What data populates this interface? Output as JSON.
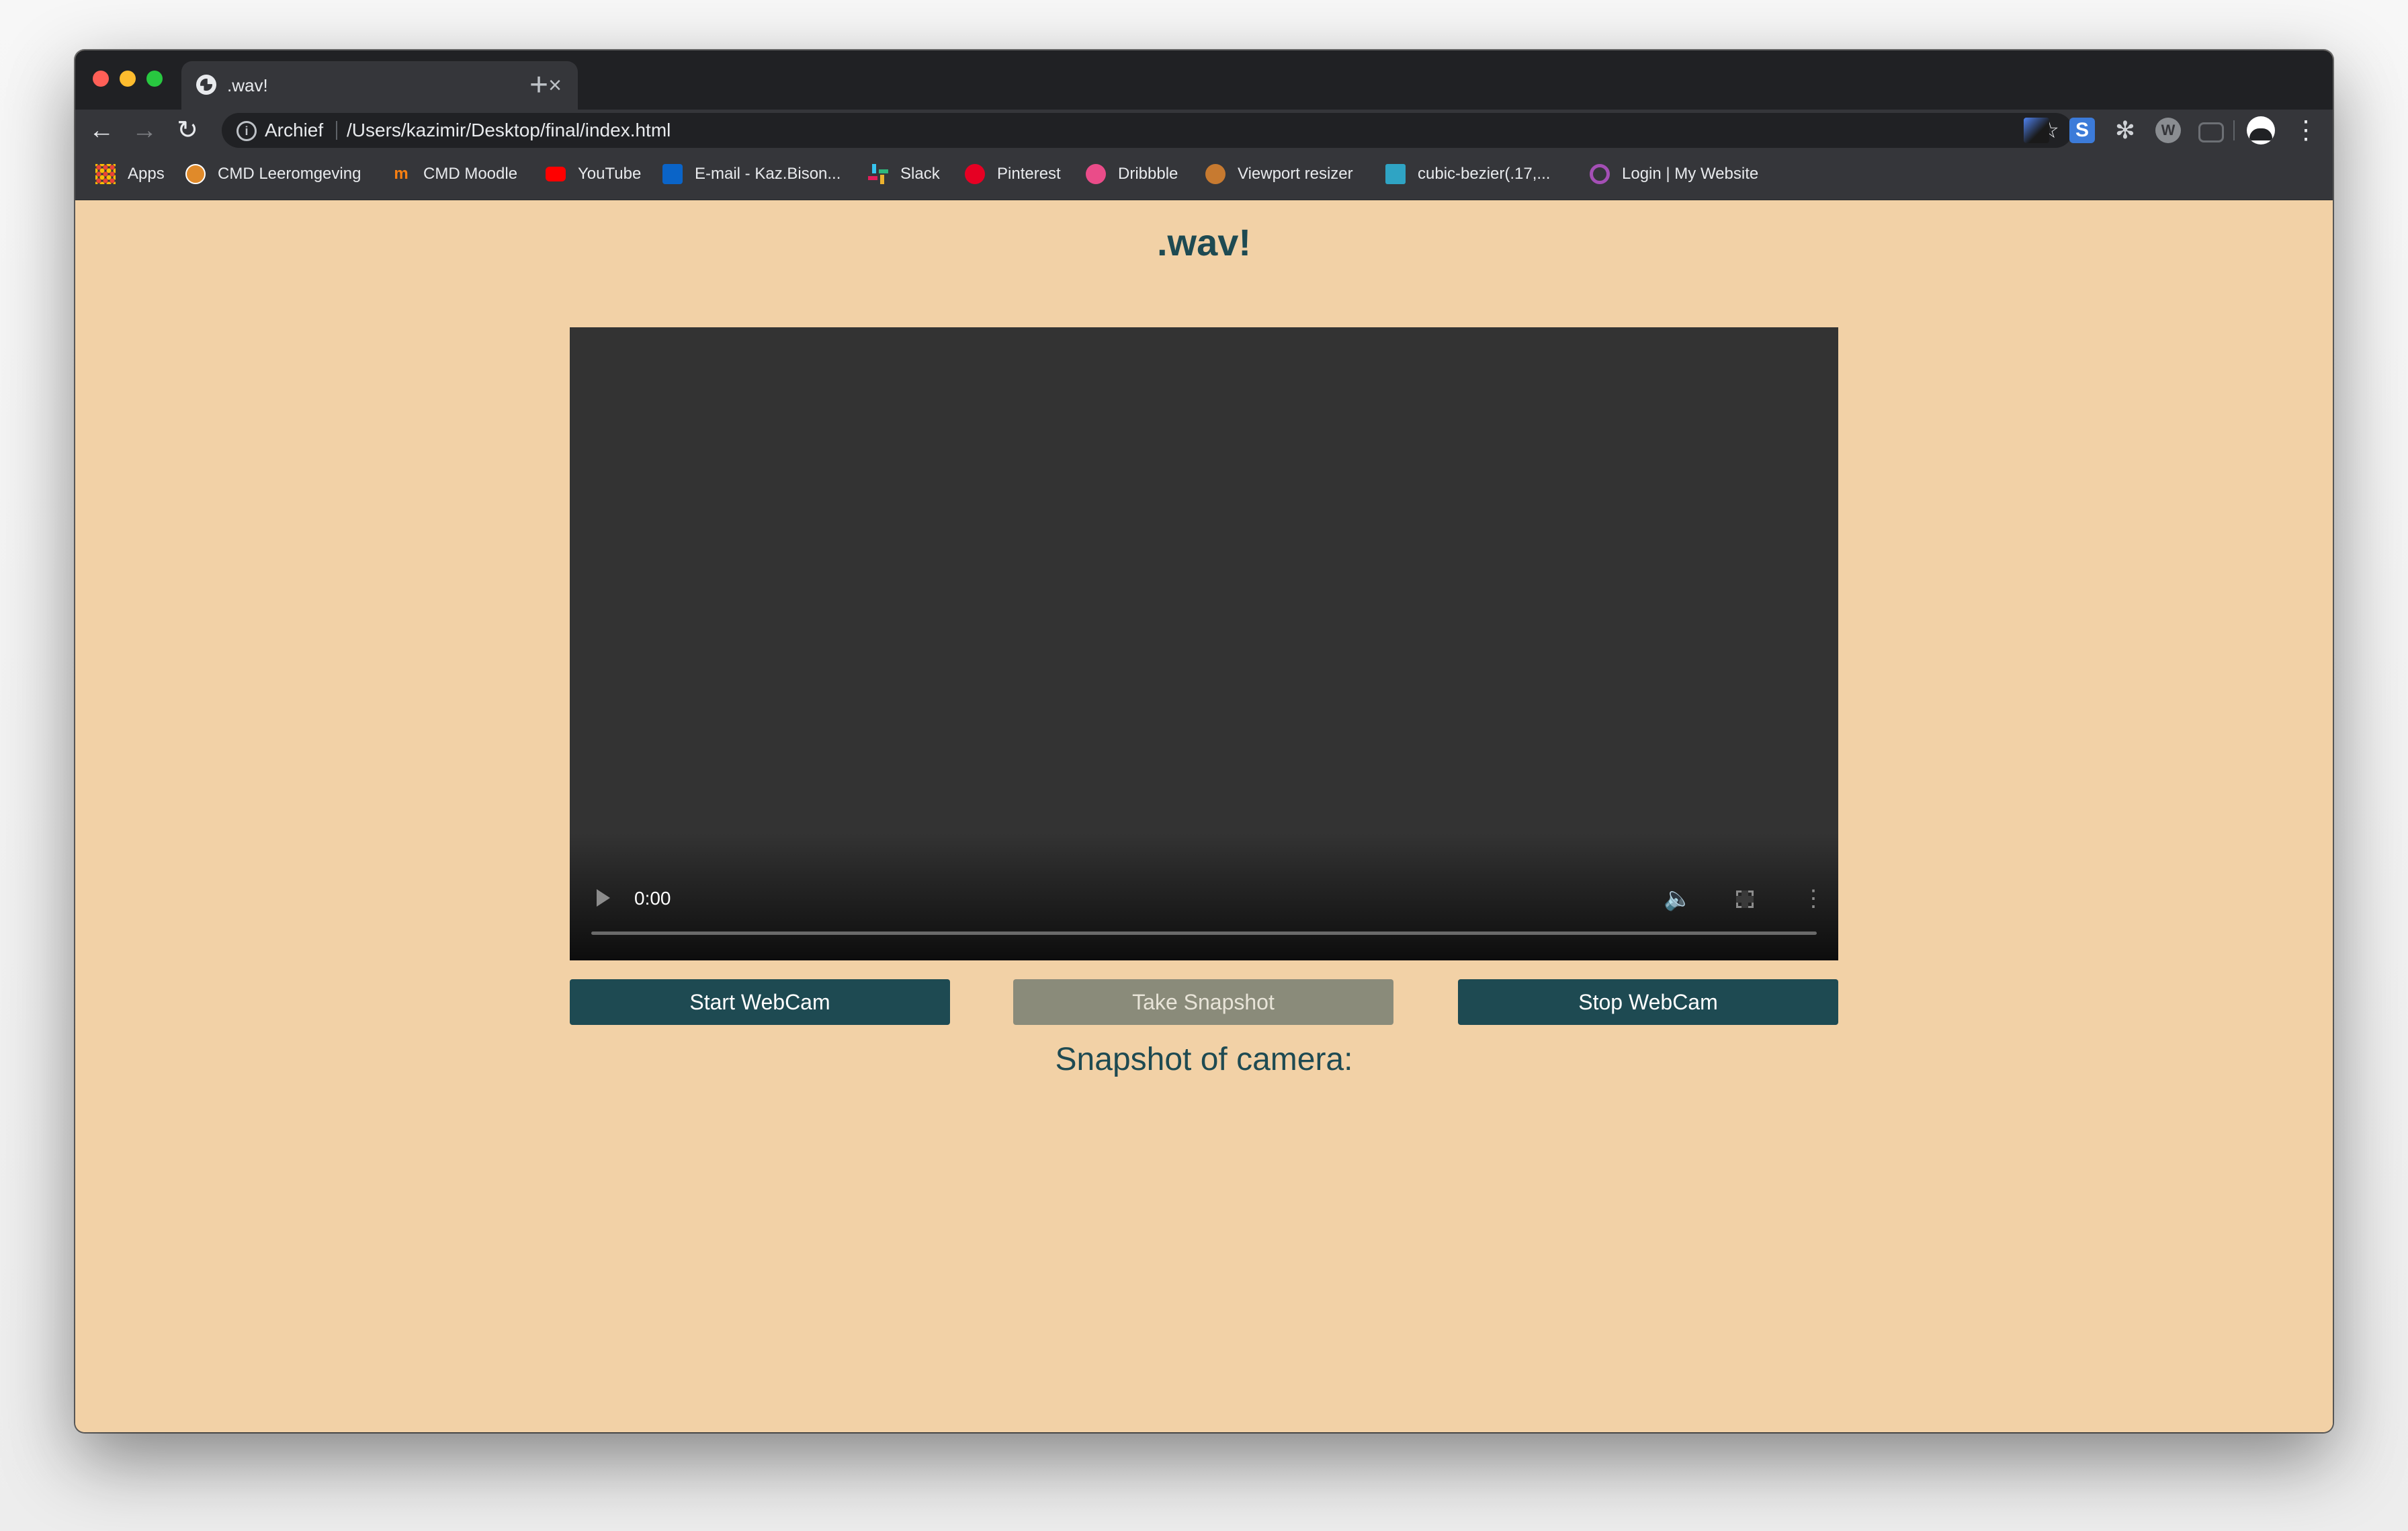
{
  "browser": {
    "tab_title": ".wav!",
    "tab_close_glyph": "×",
    "new_tab_glyph": "+",
    "nav": {
      "back_glyph": "←",
      "forward_glyph": "→",
      "reload_glyph": "↻"
    },
    "omnibox": {
      "info_glyph": "i",
      "security_label": "Archief",
      "url": "/Users/kazimir/Desktop/final/index.html",
      "star_glyph": "☆"
    },
    "extensions": [
      {
        "icon": "extension-tab-icon",
        "glyph": ""
      },
      {
        "icon": "stylish-s-icon",
        "glyph": "S"
      },
      {
        "icon": "gear-icon",
        "glyph": "✻"
      },
      {
        "icon": "wappalyzer-icon",
        "glyph": "W"
      },
      {
        "icon": "vr-headset-icon",
        "glyph": ""
      }
    ],
    "menu_glyph": "⋮",
    "bookmarks": [
      {
        "label": "Apps",
        "icon": "apps-grid-icon"
      },
      {
        "label": "CMD Leeromgeving",
        "icon": "cmd-icon"
      },
      {
        "label": "CMD Moodle",
        "icon": "moodle-icon",
        "glyph": "m"
      },
      {
        "label": "YouTube",
        "icon": "youtube-icon"
      },
      {
        "label": "E-mail - Kaz.Bison...",
        "icon": "outlook-icon"
      },
      {
        "label": "Slack",
        "icon": "slack-icon"
      },
      {
        "label": "Pinterest",
        "icon": "pinterest-icon"
      },
      {
        "label": "Dribbble",
        "icon": "dribbble-icon"
      },
      {
        "label": "Viewport resizer",
        "icon": "viewport-icon"
      },
      {
        "label": "cubic-bezier(.17,...",
        "icon": "cubic-bezier-icon"
      },
      {
        "label": "Login | My Website",
        "icon": "login-icon"
      }
    ]
  },
  "page": {
    "title": ".wav!",
    "video": {
      "current_time": "0:00",
      "progress": 0,
      "play_icon": "play-icon",
      "volume_glyph": "🔈",
      "menu_glyph": "⋮"
    },
    "buttons": {
      "start": "Start WebCam",
      "snapshot": "Take Snapshot",
      "stop": "Stop WebCam"
    },
    "snapshot_heading": "Snapshot of camera:"
  },
  "colors": {
    "page_background": "#f2d1a6",
    "accent": "#1e4a52",
    "disabled_button": "#8a8b7a",
    "video_background": "#333333"
  }
}
